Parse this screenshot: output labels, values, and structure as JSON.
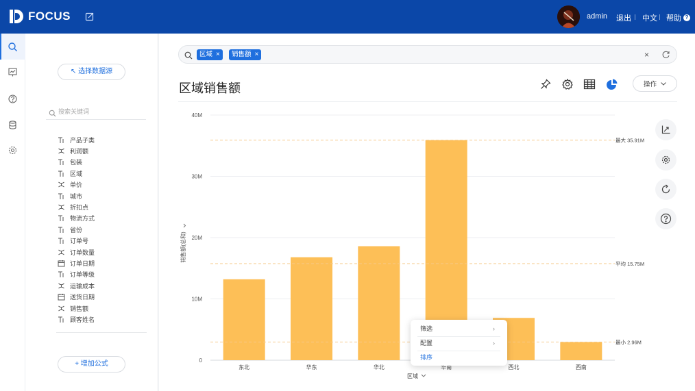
{
  "app": {
    "name": "FOCUS"
  },
  "header": {
    "username": "admin",
    "logout": "退出",
    "language": "中文",
    "help": "帮助",
    "help_icon": "?"
  },
  "rail": {
    "icons": [
      "search-icon",
      "dashboard-icon",
      "question-icon",
      "database-icon",
      "gear-icon"
    ]
  },
  "field_panel": {
    "select_source_label": "↖ 选择数据源",
    "search_placeholder": "搜索关键词",
    "fields": [
      {
        "label": "产品子类",
        "type": "text"
      },
      {
        "label": "利润额",
        "type": "measure"
      },
      {
        "label": "包装",
        "type": "text"
      },
      {
        "label": "区域",
        "type": "text"
      },
      {
        "label": "单价",
        "type": "measure"
      },
      {
        "label": "城市",
        "type": "text"
      },
      {
        "label": "折扣点",
        "type": "measure"
      },
      {
        "label": "物流方式",
        "type": "text"
      },
      {
        "label": "省份",
        "type": "text"
      },
      {
        "label": "订单号",
        "type": "text"
      },
      {
        "label": "订单数量",
        "type": "measure"
      },
      {
        "label": "订单日期",
        "type": "date"
      },
      {
        "label": "订单等级",
        "type": "text"
      },
      {
        "label": "运输成本",
        "type": "measure"
      },
      {
        "label": "送货日期",
        "type": "date"
      },
      {
        "label": "销售额",
        "type": "measure"
      },
      {
        "label": "顾客姓名",
        "type": "text"
      }
    ],
    "add_formula_label": "+ 增加公式"
  },
  "search_bar": {
    "chips": [
      {
        "label": "区域"
      },
      {
        "label": "销售额"
      }
    ],
    "clear": "×"
  },
  "chart_header": {
    "title": "区域销售额",
    "ops_label": "操作",
    "tools": [
      "pin-icon",
      "settings-icon",
      "table-icon",
      "pie-chart-icon"
    ]
  },
  "side_tools": [
    "axis-icon",
    "gear-icon",
    "refresh-icon",
    "question-icon"
  ],
  "colors": {
    "brand": "#0b47a8",
    "accent": "#1f6fde",
    "bar": "#fdbf57",
    "reference_line": "#f6c98a"
  },
  "context_menu": {
    "items": [
      {
        "label": "筛选",
        "has_submenu": true
      },
      {
        "label": "配置",
        "has_submenu": true
      },
      {
        "label": "排序",
        "has_submenu": false
      }
    ]
  },
  "chart_data": {
    "type": "bar",
    "categories": [
      "东北",
      "华东",
      "华北",
      "华南",
      "西北",
      "西南"
    ],
    "values": [
      13.2,
      16.8,
      18.6,
      35.91,
      6.9,
      2.96
    ],
    "unit": "M",
    "xlabel": "区域",
    "ylabel": "销售额(总和)",
    "ylim": [
      0,
      40
    ],
    "yticks": [
      "0",
      "10M",
      "20M",
      "30M",
      "40M"
    ],
    "reference_lines": [
      {
        "label": "最大 35.91M",
        "value": 35.91
      },
      {
        "label": "平均 15.75M",
        "value": 15.75
      },
      {
        "label": "最小 2.96M",
        "value": 2.96
      }
    ],
    "grid": true
  }
}
